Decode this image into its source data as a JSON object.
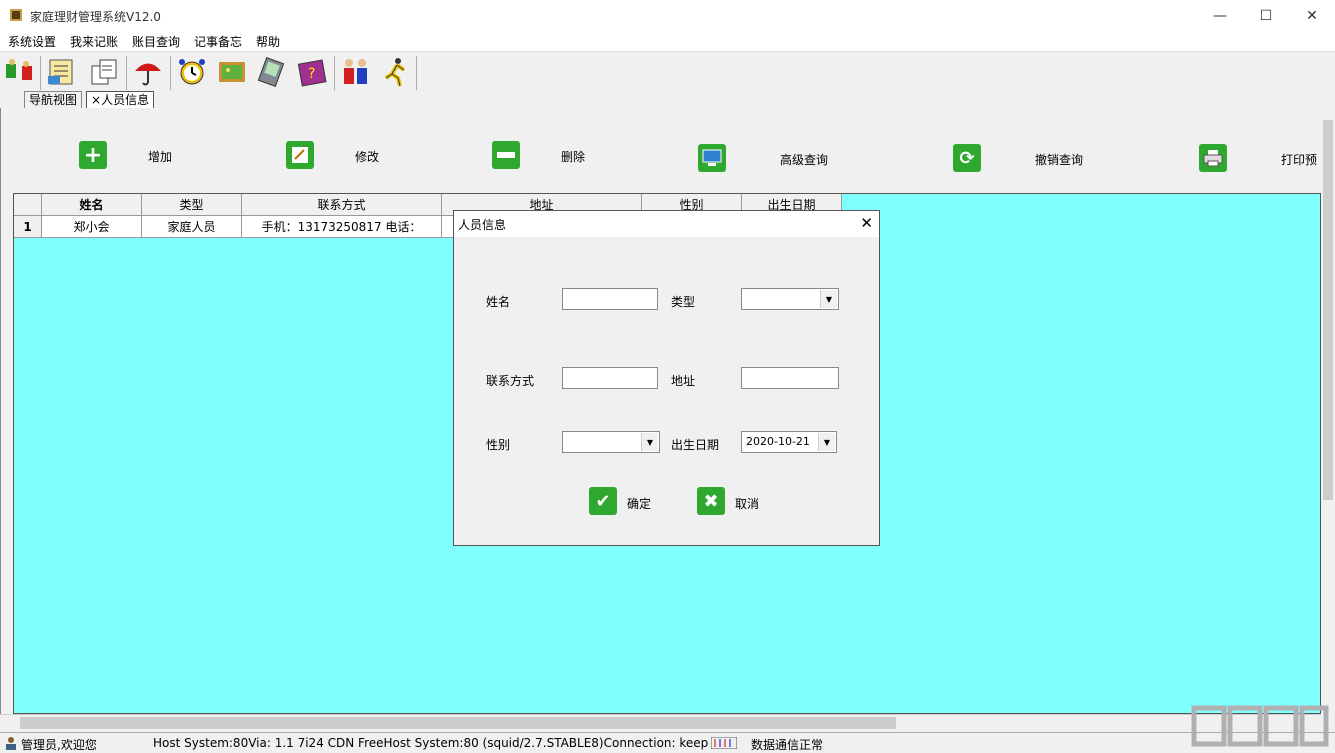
{
  "window": {
    "title": "家庭理财管理系统V12.0",
    "min_glyph": "—",
    "max_glyph": "☐",
    "close_glyph": "✕"
  },
  "menu": [
    "系统设置",
    "我来记账",
    "账目查询",
    "记事备忘",
    "帮助"
  ],
  "tabs": [
    {
      "label": "导航视图"
    },
    {
      "label": "人员信息",
      "close_glyph": "×"
    }
  ],
  "actions": {
    "add": "增加",
    "edit": "修改",
    "delete": "删除",
    "advanced_search": "高级查询",
    "cancel_search": "撤销查询",
    "print_preview": "打印预"
  },
  "grid": {
    "columns": [
      "姓名",
      "类型",
      "联系方式",
      "地址",
      "性别",
      "出生日期"
    ],
    "rows": [
      {
        "index": "1",
        "name": "郑小会",
        "type": "家庭人员",
        "contact": "手机：13173250817 电话：",
        "address": "",
        "gender": "",
        "birth": ""
      }
    ]
  },
  "dialog": {
    "title": "人员信息",
    "close_glyph": "✕",
    "name_label": "姓名",
    "name_value": "",
    "type_label": "类型",
    "type_value": "",
    "contact_label": "联系方式",
    "contact_value": "",
    "address_label": "地址",
    "address_value": "",
    "gender_label": "性别",
    "gender_value": "",
    "birth_label": "出生日期",
    "birth_value": "2020-10-21",
    "ok_label": "确定",
    "cancel_label": "取消"
  },
  "status": {
    "user": "管理员,欢迎您",
    "host": "Host System:80Via: 1.1 7i24 CDN FreeHost System:80 (squid/2.7.STABLE8)Connection: keep-aliv",
    "comm": "数据通信正常"
  },
  "colors": {
    "grid_bg": "#80ffff",
    "green": "#2fa82f"
  }
}
